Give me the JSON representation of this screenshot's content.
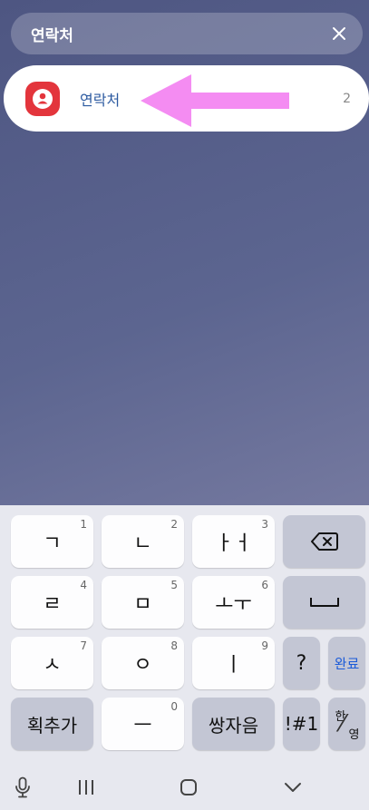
{
  "search": {
    "query": "연락처"
  },
  "result": {
    "app_name": "연락처",
    "count": "2"
  },
  "keyboard": {
    "rows": [
      [
        {
          "label": "ㄱ",
          "num": "1"
        },
        {
          "label": "ㄴ",
          "num": "2"
        },
        {
          "label": "ㅏㅓ",
          "num": "3"
        }
      ],
      [
        {
          "label": "ㄹ",
          "num": "4"
        },
        {
          "label": "ㅁ",
          "num": "5"
        },
        {
          "label": "ㅗㅜ",
          "num": "6"
        }
      ],
      [
        {
          "label": "ㅅ",
          "num": "7"
        },
        {
          "label": "ㅇ",
          "num": "8"
        },
        {
          "label": "ㅣ",
          "num": "9"
        }
      ]
    ],
    "bottom": {
      "stroke": "획추가",
      "dash": "ㅡ",
      "dash_num": "0",
      "double": "쌍자음",
      "symbols": "!#1",
      "han": "한",
      "young": "영"
    },
    "question": "?",
    "done": "완료"
  },
  "colors": {
    "accent": "#1b5bd8",
    "app_icon": "#e3353c",
    "arrow": "#f48cf2"
  }
}
